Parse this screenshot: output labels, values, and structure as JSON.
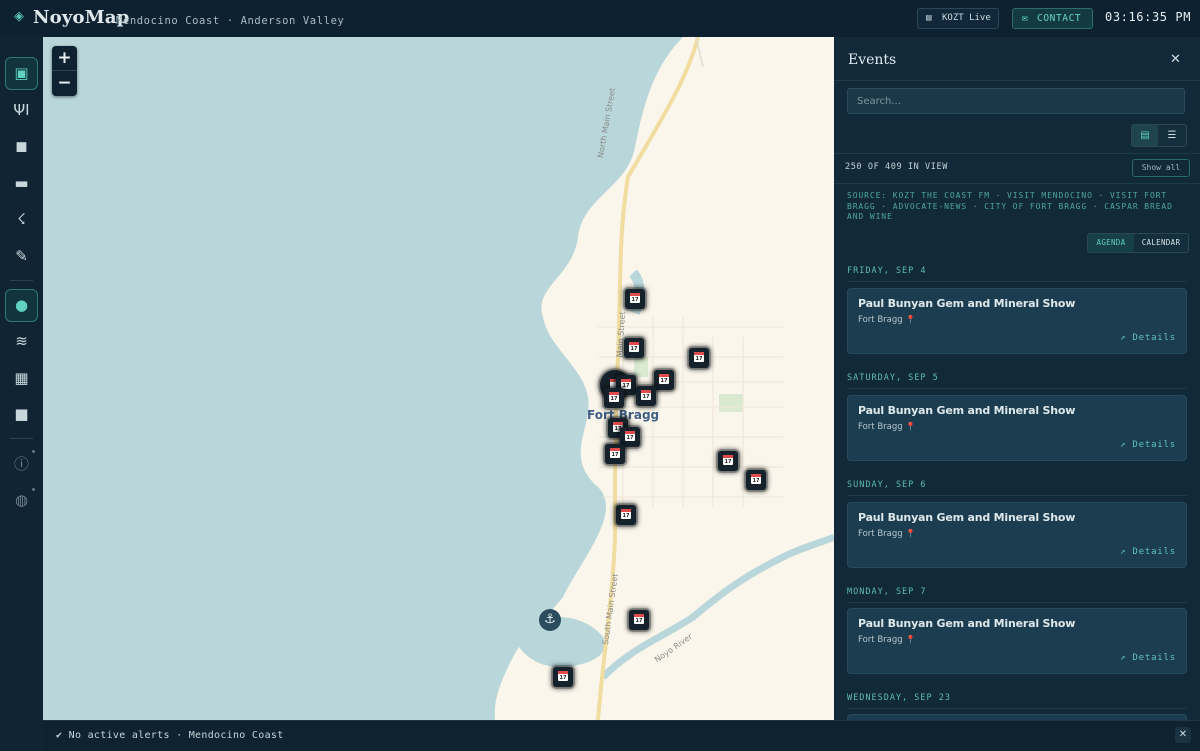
{
  "header": {
    "logo_icon": "diamond-icon",
    "title": "NoyoMap",
    "subtitle": "Mendocino Coast · Anderson Valley",
    "radio_label": "KOZT Live",
    "contact_label": "CONTACT",
    "clock": "03:16:35 PM"
  },
  "sidebar": {
    "items": [
      {
        "name": "calendar-icon",
        "glyph": "▣",
        "active": true
      },
      {
        "name": "dining-icon",
        "glyph": "✕"
      },
      {
        "name": "shopping-bag-icon",
        "glyph": "◼"
      },
      {
        "name": "lodging-bed-icon",
        "glyph": "▬"
      },
      {
        "name": "hiking-icon",
        "glyph": "☇"
      },
      {
        "name": "brush-icon",
        "glyph": "✎"
      },
      {
        "name": "location-pin-icon",
        "glyph": "●",
        "active": true
      },
      {
        "name": "waves-icon",
        "glyph": "≋"
      },
      {
        "name": "ferry-icon",
        "glyph": "▦"
      },
      {
        "name": "video-camera-icon",
        "glyph": "■"
      },
      {
        "name": "info-icon",
        "glyph": "ⓘ",
        "dim": true
      },
      {
        "name": "train-icon",
        "glyph": "◍",
        "dim": true
      }
    ]
  },
  "map": {
    "zoom_in": "+",
    "zoom_out": "−",
    "town": "Fort Bragg",
    "street_north": "North Main Street",
    "street_south": "South Main Street",
    "street_mid": "Main Street",
    "river": "Noyo River",
    "marker_glyph": "17",
    "anchor_icon": "⚓"
  },
  "alert": {
    "text": "✔ No active alerts · Mendocino Coast",
    "close": "✕"
  },
  "events": {
    "title": "Events",
    "close": "✕",
    "search_placeholder": "Search...",
    "count_text": "250 OF 409 IN VIEW",
    "show_all": "Show all",
    "source_text": "SOURCE: KOZT THE COAST FM · VISIT MENDOCINO · VISIT FORT BRAGG · ADVOCATE-NEWS · CITY OF FORT BRAGG · CASPAR BREAD AND WINE",
    "mode_agenda": "AGENDA",
    "mode_calendar": "CALENDAR",
    "days": [
      {
        "heading": "FRIDAY, SEP 4",
        "event": {
          "title": "Paul Bunyan Gem and Mineral Show",
          "location": "Fort Bragg",
          "details": "↗ Details"
        }
      },
      {
        "heading": "SATURDAY, SEP 5",
        "event": {
          "title": "Paul Bunyan Gem and Mineral Show",
          "location": "Fort Bragg",
          "details": "↗ Details"
        }
      },
      {
        "heading": "SUNDAY, SEP 6",
        "event": {
          "title": "Paul Bunyan Gem and Mineral Show",
          "location": "Fort Bragg",
          "details": "↗ Details"
        }
      },
      {
        "heading": "MONDAY, SEP 7",
        "event": {
          "title": "Paul Bunyan Gem and Mineral Show",
          "location": "Fort Bragg",
          "details": "↗ Details"
        }
      },
      {
        "heading": "WEDNESDAY, SEP 23"
      }
    ]
  }
}
